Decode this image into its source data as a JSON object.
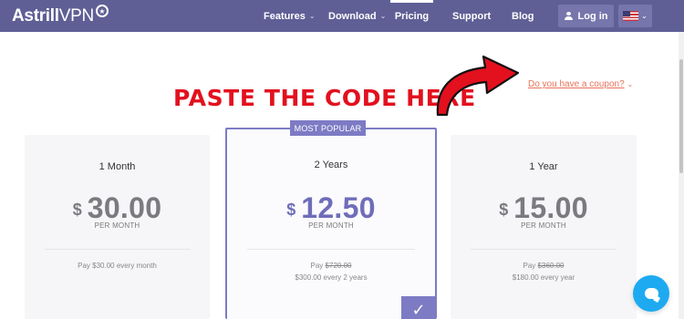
{
  "header": {
    "logo_bold": "Astrill",
    "logo_light": "VPN",
    "nav": {
      "features": "Features",
      "download": "Download",
      "pricing": "Pricing",
      "support": "Support",
      "blog": "Blog"
    },
    "login_label": "Log in",
    "language_flag": "us-flag-icon"
  },
  "promo": {
    "overlay_text": "PASTE THE CODE HERE",
    "coupon_link": "Do you have a coupon?"
  },
  "plans": [
    {
      "term": "1 Month",
      "currency": "$",
      "price": "30.00",
      "per_month": "PER MONTH",
      "pay_line_1": "Pay $30.00 every month"
    },
    {
      "badge": "MOST POPULAR",
      "term": "2 Years",
      "currency": "$",
      "price": "12.50",
      "per_month": "PER MONTH",
      "pay_prefix": "Pay",
      "pay_original": "$720.00",
      "pay_line_2": "$300.00 every 2 years"
    },
    {
      "term": "1 Year",
      "currency": "$",
      "price": "15.00",
      "per_month": "PER MONTH",
      "pay_prefix": "Pay",
      "pay_original": "$360.00",
      "pay_line_2": "$180.00 every year"
    }
  ],
  "colors": {
    "nav_bg": "#5f5f96",
    "accent_purple": "#7d7bc4",
    "overlay_red": "#e3101e",
    "coupon_orange": "#e8725a",
    "chat_blue": "#1eaaf1"
  },
  "icons": {
    "chat": "chat-bubble-icon",
    "check": "checkmark-icon",
    "user": "user-icon"
  }
}
